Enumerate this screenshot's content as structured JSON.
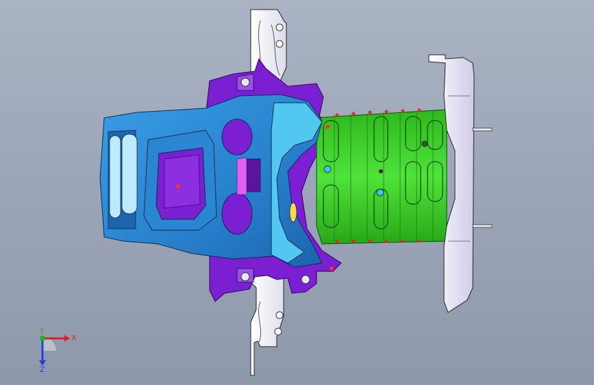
{
  "viewport": {
    "background_top": "#aab3c3",
    "background_bottom": "#8e98ab"
  },
  "model": {
    "parts": [
      {
        "name": "white-plate",
        "color": "#ffffff"
      },
      {
        "name": "purple-bracket",
        "color": "#7a1fd1"
      },
      {
        "name": "blue-casting",
        "color": "#2f8fd8"
      },
      {
        "name": "green-channel",
        "color": "#34d21f"
      },
      {
        "name": "end-cap-plate",
        "color": "#e6e4f4"
      }
    ]
  },
  "triad": {
    "x_label": "X",
    "y_label": "Y",
    "z_label": "Z",
    "x_color": "#e02020",
    "y_color": "#20b020",
    "z_color": "#2040e0"
  }
}
